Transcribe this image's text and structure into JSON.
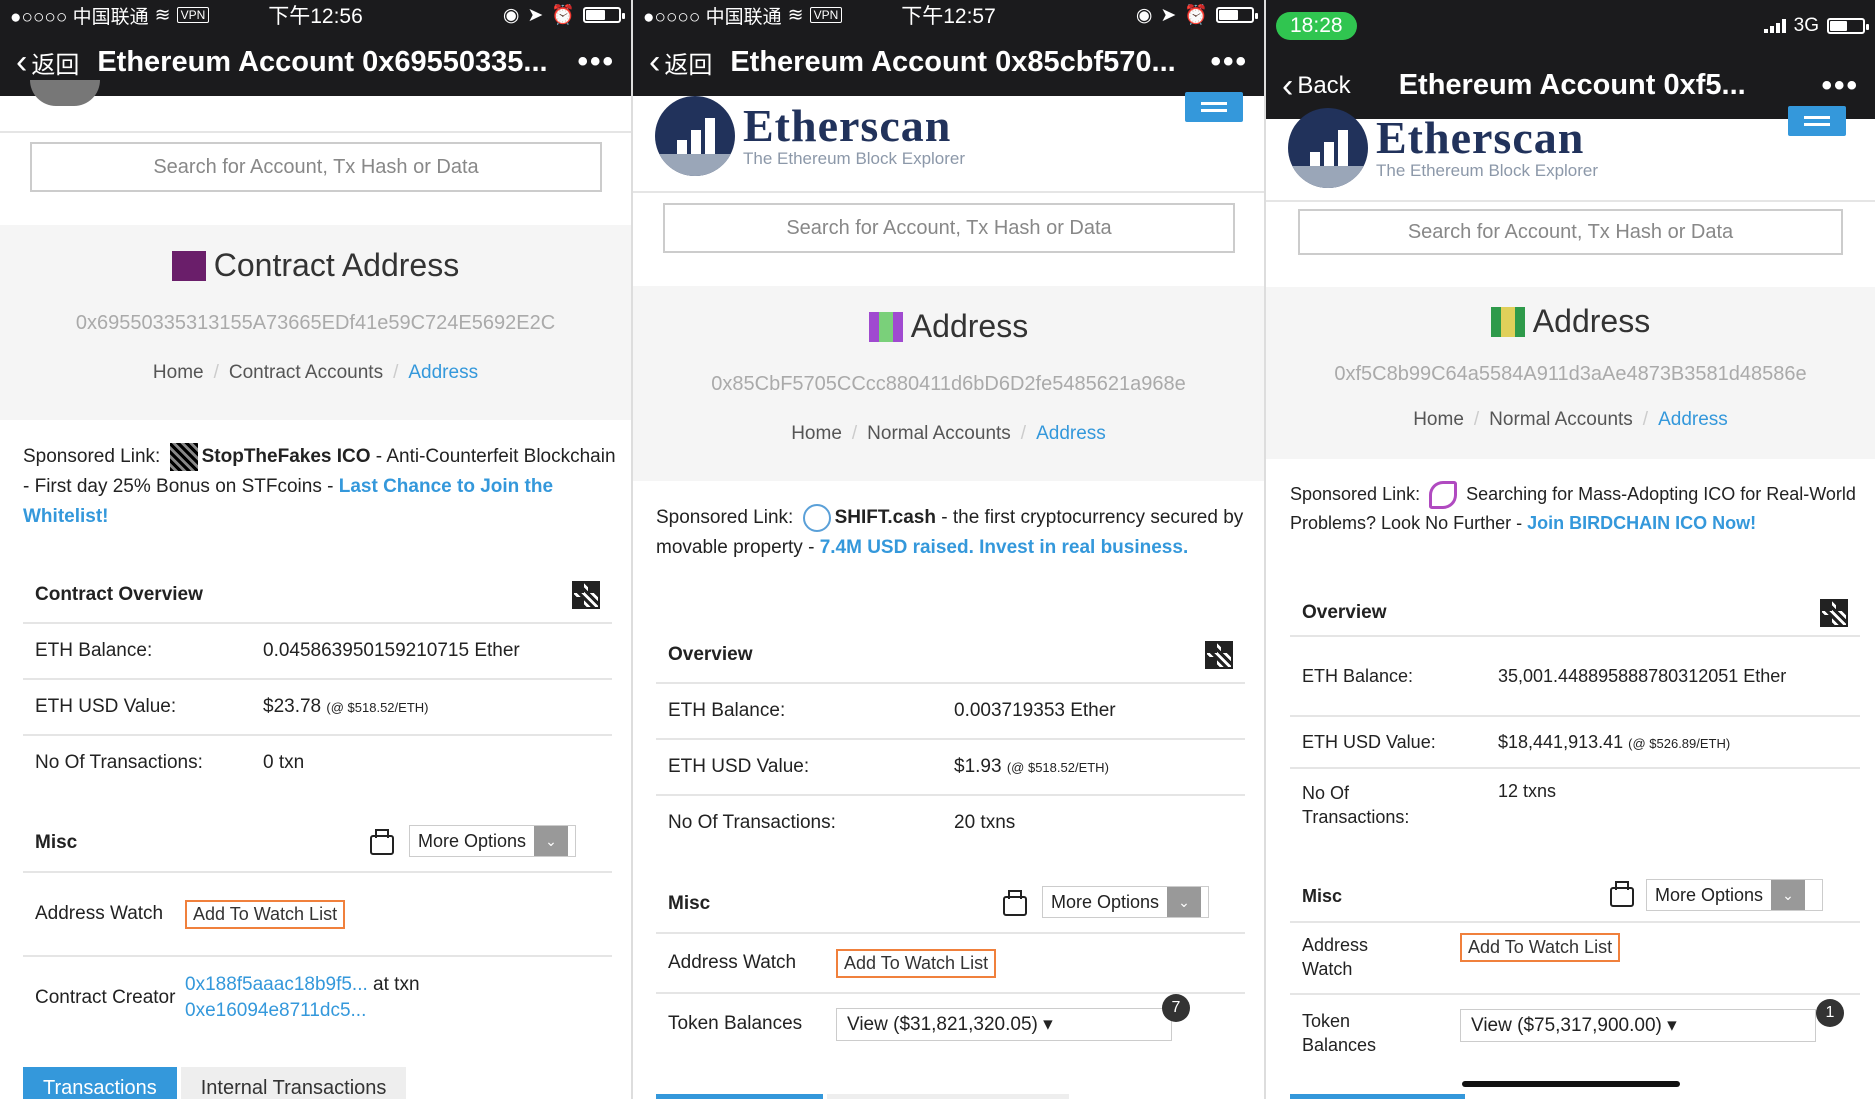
{
  "panel1": {
    "status": {
      "carrier": "●○○○○ 中国联通",
      "vpn": "VPN",
      "time": "下午12:56",
      "battery_level": 0.55
    },
    "nav": {
      "back": "返回",
      "title": "Ethereum Account 0x69550335...",
      "more": "•••"
    },
    "search_placeholder": "Search for Account, Tx Hash or Data",
    "hero_title": "Contract Address",
    "address": "0x69550335313155A73665EDf41e59C724E5692E2C",
    "crumbs": [
      "Home",
      "Contract Accounts",
      "Address"
    ],
    "sponsored": {
      "label": "Sponsored Link:",
      "name": "StopTheFakes ICO",
      "text": " - Anti-Counterfeit Blockchain - First day 25% Bonus on STFcoins - ",
      "cta": "Last Chance to Join the Whitelist!"
    },
    "overview_title": "Contract Overview",
    "rows": [
      {
        "label": "ETH Balance:",
        "value": "0.045863950159210715 Ether",
        "note": ""
      },
      {
        "label": "ETH USD Value:",
        "value": "$23.78",
        "note": "(@ $518.52/ETH)"
      },
      {
        "label": "No Of Transactions:",
        "value": "0 txn",
        "note": ""
      }
    ],
    "misc": "Misc",
    "more_options": "More Options",
    "watch_label": "Address Watch",
    "watch_button": "Add To Watch List",
    "creator_label": "Contract Creator",
    "creator_addr": "0x188f5aaac18b9f5...",
    "creator_at": " at txn ",
    "creator_txn": "0xe16094e8711dc5...",
    "tabs": [
      "Transactions",
      "Internal Transactions"
    ]
  },
  "panel2": {
    "status": {
      "carrier": "●○○○○ 中国联通",
      "vpn": "VPN",
      "time": "下午12:57",
      "battery_level": 0.55
    },
    "nav": {
      "back": "返回",
      "title": "Ethereum Account 0x85cbf570...",
      "more": "•••"
    },
    "logo_big": "Etherscan",
    "logo_small": "The Ethereum Block Explorer",
    "search_placeholder": "Search for Account, Tx Hash or Data",
    "hero_title": "Address",
    "address": "0x85CbF5705CCcc880411d6bD6D2fe5485621a968e",
    "crumbs": [
      "Home",
      "Normal Accounts",
      "Address"
    ],
    "sponsored": {
      "label": "Sponsored Link:",
      "name": "SHIFT.cash",
      "text": " - the first cryptocurrency secured by movable property - ",
      "cta": "7.4M USD raised. Invest in real business."
    },
    "overview_title": "Overview",
    "rows": [
      {
        "label": "ETH Balance:",
        "value": "0.003719353 Ether",
        "note": ""
      },
      {
        "label": "ETH USD Value:",
        "value": "$1.93",
        "note": "(@ $518.52/ETH)"
      },
      {
        "label": "No Of Transactions:",
        "value": "20 txns",
        "note": ""
      }
    ],
    "misc": "Misc",
    "more_options": "More Options",
    "watch_label": "Address Watch",
    "watch_button": "Add To Watch List",
    "token_label": "Token Balances",
    "token_view": "View ($31,821,320.05) ▾",
    "token_count": "7"
  },
  "panel3": {
    "status": {
      "time": "18:28",
      "network": "3G",
      "battery_level": 0.5
    },
    "nav": {
      "back": "Back",
      "title": "Ethereum Account 0xf5...",
      "more": "•••"
    },
    "logo_big": "Etherscan",
    "logo_small": "The Ethereum Block Explorer",
    "search_placeholder": "Search for Account, Tx Hash or Data",
    "hero_title": "Address",
    "address": "0xf5C8b99C64a5584A911d3aAe4873B3581d48586e",
    "crumbs": [
      "Home",
      "Normal Accounts",
      "Address"
    ],
    "sponsored": {
      "label": "Sponsored Link:",
      "text": " Searching for Mass-Adopting ICO for Real-World Problems? Look No Further - ",
      "cta": "Join BIRDCHAIN ICO Now!"
    },
    "overview_title": "Overview",
    "rows": [
      {
        "label": "ETH Balance:",
        "value": "35,001.448895888780312051 Ether",
        "note": ""
      },
      {
        "label": "ETH USD Value:",
        "value": "$18,441,913.41",
        "note": "(@ $526.89/ETH)"
      },
      {
        "label": "No Of Transactions:",
        "value": "12 txns",
        "note": ""
      }
    ],
    "misc": "Misc",
    "more_options": "More Options",
    "watch_label": "Address Watch",
    "watch_button": "Add To Watch List",
    "token_label": "Token Balances",
    "token_view": "View ($75,317,900.00) ▾",
    "token_count": "1"
  },
  "colors": {
    "accent": "#3498db",
    "topbar": "#1b1b1d",
    "watch_border": "#f0803c",
    "hero_bg": "#f5f5f5"
  }
}
